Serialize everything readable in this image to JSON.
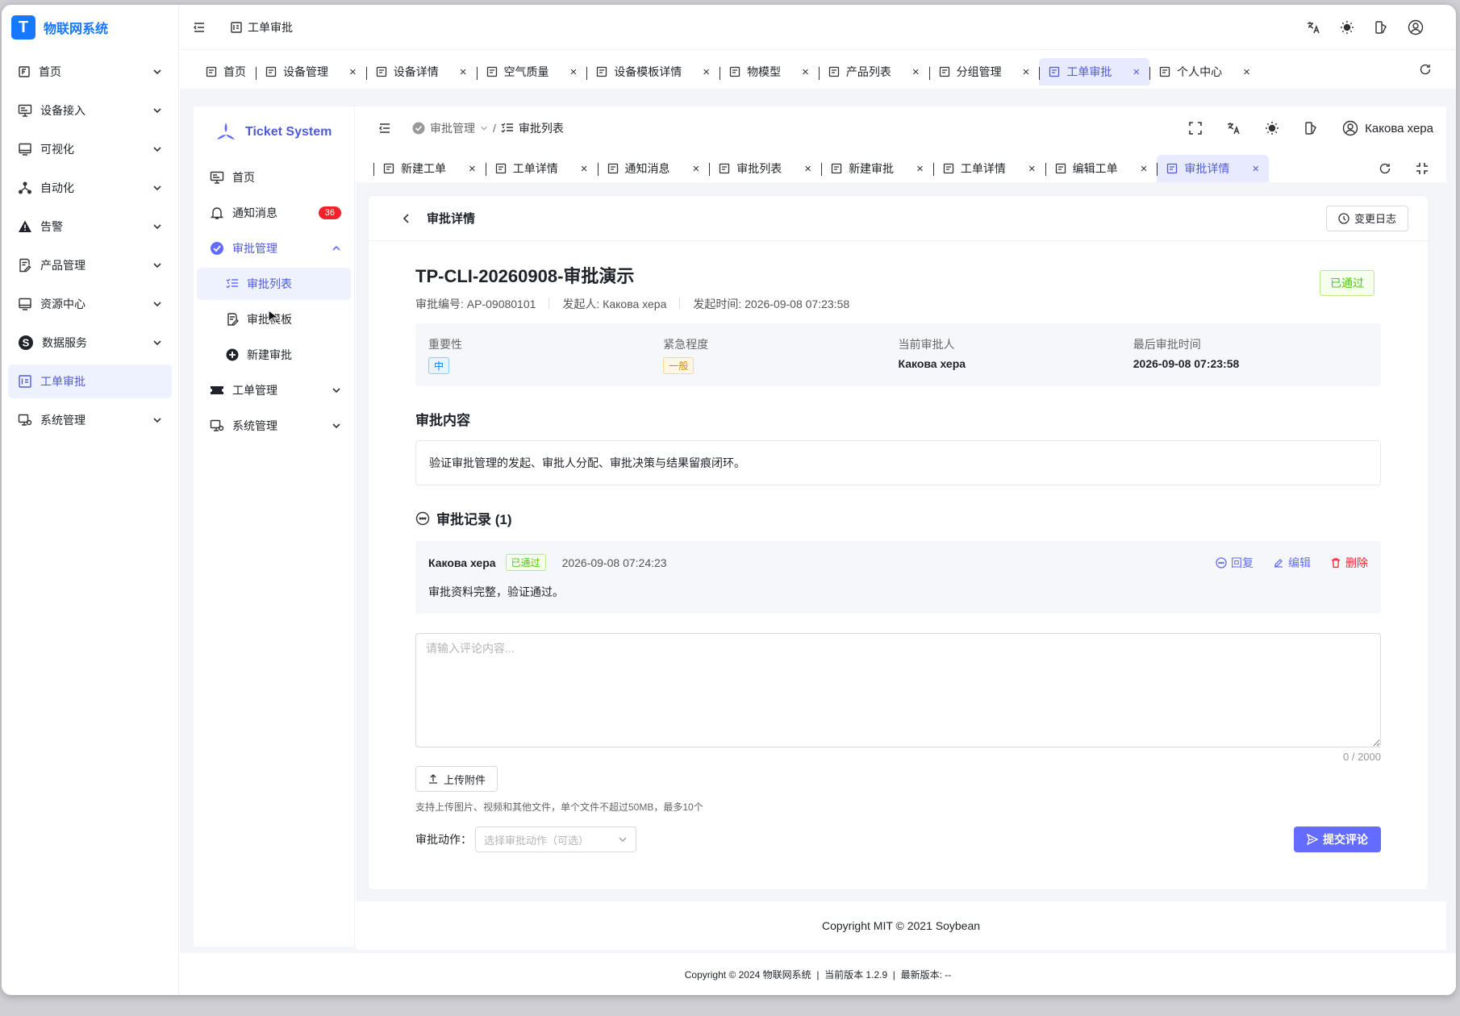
{
  "outer": {
    "app_name": "物联网系统",
    "header_crumb": "工单审批",
    "sidebar": [
      {
        "label": "首页",
        "icon": "home-icon"
      },
      {
        "label": "设备接入",
        "icon": "monitor-icon"
      },
      {
        "label": "可视化",
        "icon": "screen-icon"
      },
      {
        "label": "自动化",
        "icon": "flow-icon"
      },
      {
        "label": "告警",
        "icon": "warning-icon"
      },
      {
        "label": "产品管理",
        "icon": "product-icon"
      },
      {
        "label": "资源中心",
        "icon": "resource-icon"
      },
      {
        "label": "数据服务",
        "icon": "data-service-icon"
      },
      {
        "label": "工单审批",
        "icon": "ticket-approval-icon",
        "active": true
      },
      {
        "label": "系统管理",
        "icon": "system-icon"
      }
    ],
    "tabs": [
      {
        "label": "首页"
      },
      {
        "label": "设备管理"
      },
      {
        "label": "设备详情"
      },
      {
        "label": "空气质量"
      },
      {
        "label": "设备模板详情"
      },
      {
        "label": "物模型"
      },
      {
        "label": "产品列表"
      },
      {
        "label": "分组管理"
      },
      {
        "label": "工单审批",
        "active": true
      },
      {
        "label": "个人中心"
      }
    ],
    "footer": "Copyright © 2024 物联网系统  |  当前版本 1.2.9  |  最新版本: --"
  },
  "inner": {
    "app_name": "Ticket System",
    "user": "Какова хера",
    "breadcrumb": {
      "parent": "审批管理",
      "current": "审批列表"
    },
    "sidebar": {
      "home": "首页",
      "notifications": "通知消息",
      "notification_count": "36",
      "approval_mgmt": "审批管理",
      "approval_list": "审批列表",
      "approval_template": "审批模板",
      "new_approval": "新建审批",
      "ticket_mgmt": "工单管理",
      "system_mgmt": "系统管理"
    },
    "tabs": [
      {
        "label": "新建工单"
      },
      {
        "label": "工单详情"
      },
      {
        "label": "通知消息"
      },
      {
        "label": "审批列表"
      },
      {
        "label": "新建审批"
      },
      {
        "label": "工单详情"
      },
      {
        "label": "编辑工单"
      },
      {
        "label": "审批详情",
        "active": true
      }
    ],
    "footer": "Copyright MIT © 2021 Soybean"
  },
  "detail": {
    "page_title": "审批详情",
    "change_log": "变更日志",
    "title": "TP-CLI-20260908-审批演示",
    "status": "已通过",
    "number": "审批编号: AP-09080101",
    "initiator": "发起人: Какова хера",
    "initiated_at": "发起时间: 2026-09-08 07:23:58",
    "importance_label": "重要性",
    "importance": "中",
    "urgency_label": "紧急程度",
    "urgency": "一般",
    "approver_label": "当前审批人",
    "approver": "Какова хера",
    "last_time_label": "最后审批时间",
    "last_time": "2026-09-08 07:23:58",
    "content_title": "审批内容",
    "content": "验证审批管理的发起、审批人分配、审批决策与结果留痕闭环。",
    "records_title": "审批记录 (1)",
    "record": {
      "name": "Какова хера",
      "status": "已通过",
      "time": "2026-09-08 07:24:23",
      "text": "审批资料完整，验证通过。",
      "reply": "回复",
      "edit": "编辑",
      "delete": "删除"
    },
    "comment_placeholder": "请输入评论内容...",
    "char_count": "0 / 2000",
    "upload": "上传附件",
    "upload_hint": "支持上传图片、视频和其他文件，单个文件不超过50MB，最多10个",
    "action_label": "审批动作：",
    "action_placeholder": "选择审批动作（可选）",
    "submit": "提交评论"
  },
  "colors": {
    "accent": "#646cff",
    "brand": "#1677ff",
    "success": "#52c41a",
    "danger": "#f5222d"
  }
}
